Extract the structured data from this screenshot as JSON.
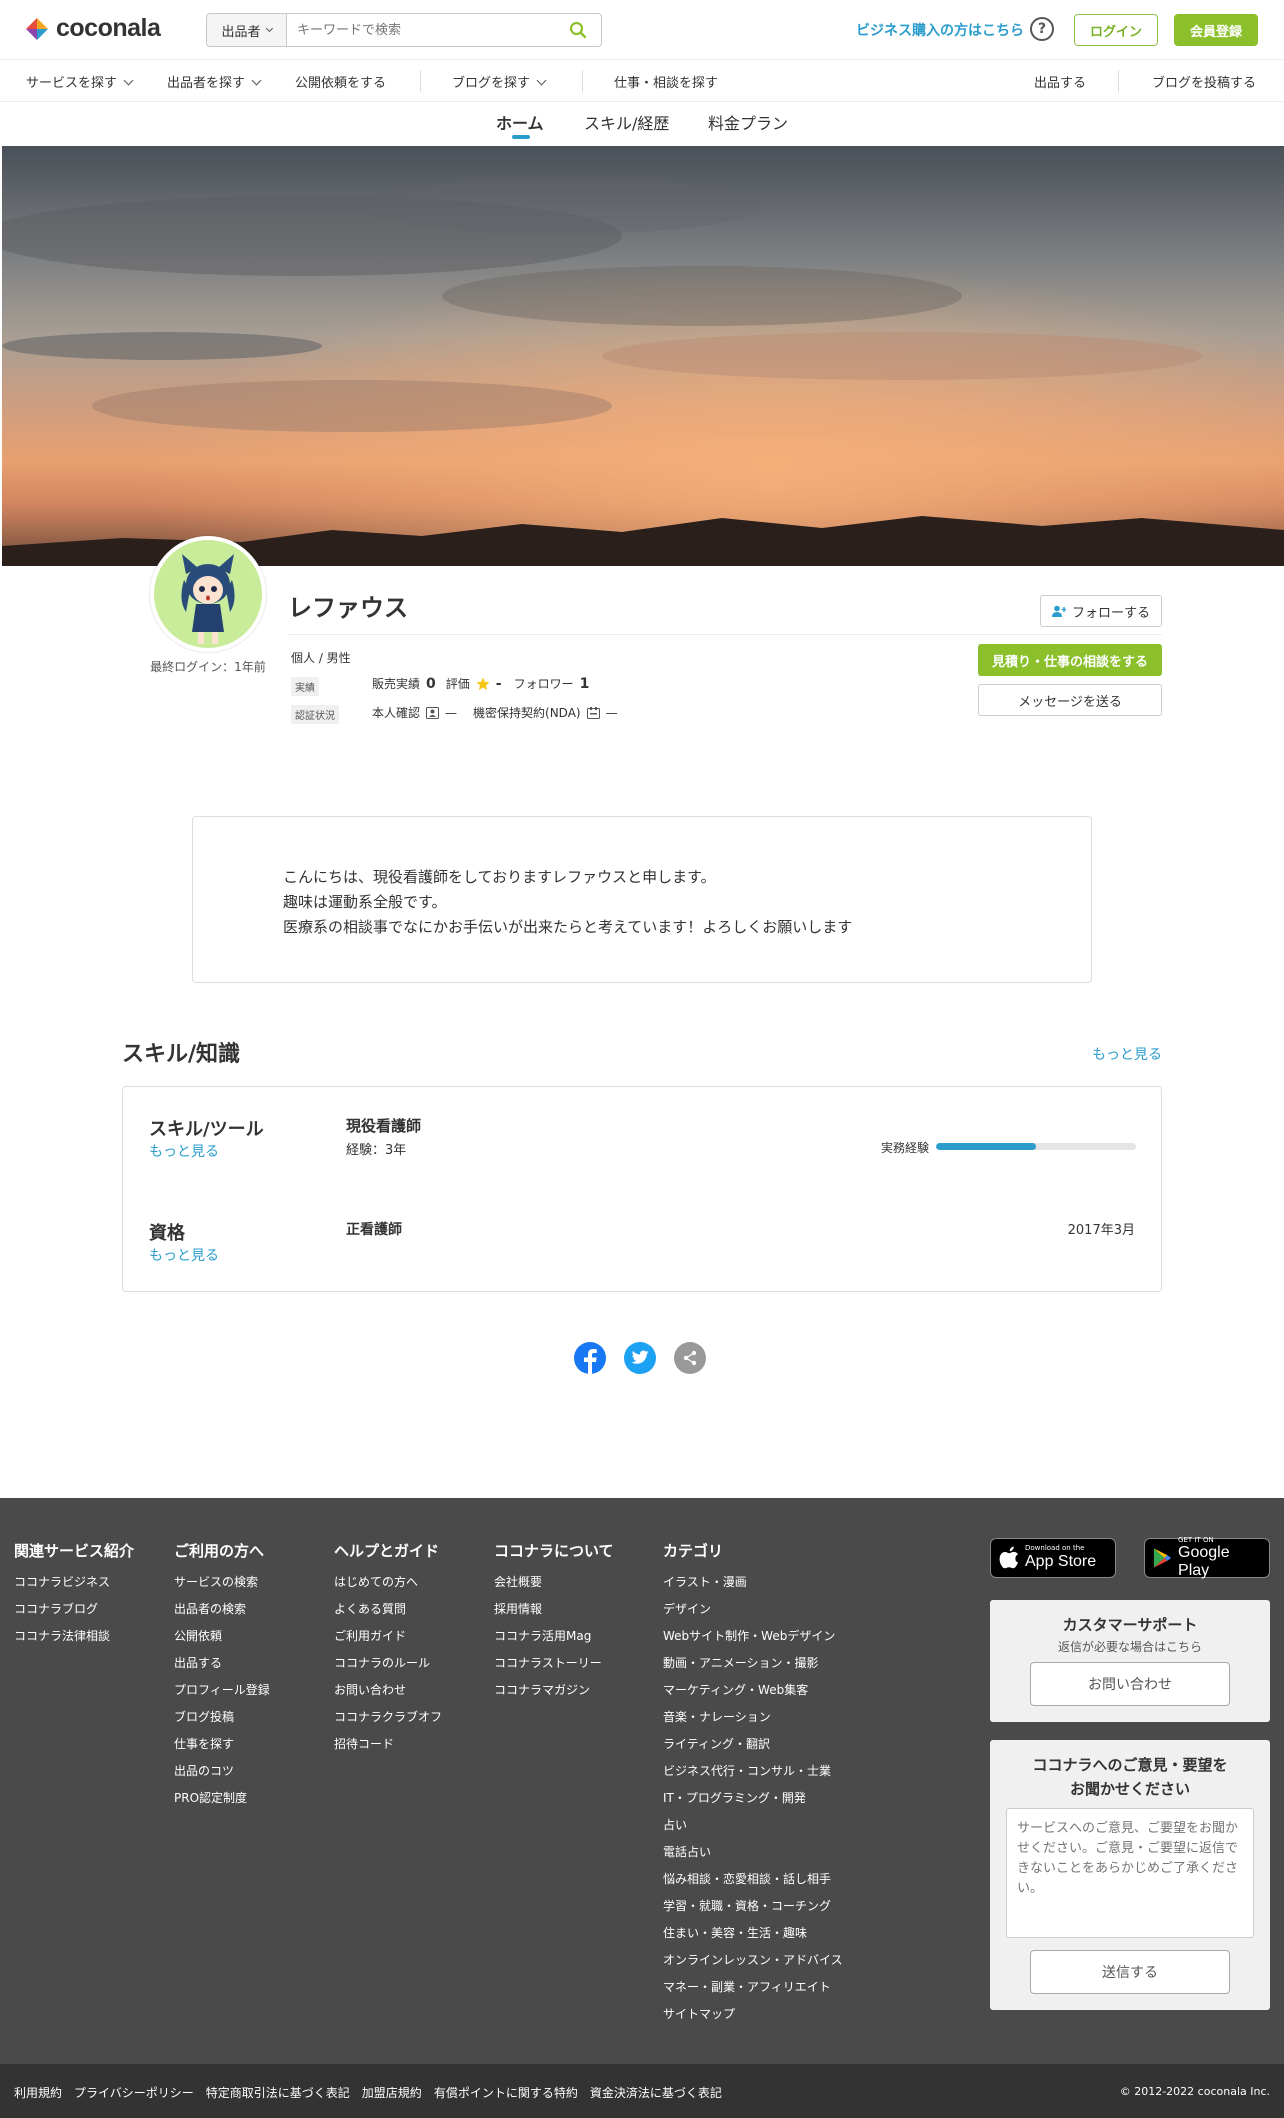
{
  "header": {
    "logo_text": "coconala",
    "search_select": "出品者",
    "search_placeholder": "キーワードで検索",
    "business_link": "ビジネス購入の方はこちら",
    "help": "?",
    "login": "ログイン",
    "signup": "会員登録"
  },
  "nav": {
    "items": [
      "サービスを探す",
      "出品者を探す",
      "公開依頼をする",
      "ブログを探す",
      "仕事・相談を探す",
      "出品する",
      "ブログを投稿する"
    ]
  },
  "tabs": [
    "ホーム",
    "スキル/経歴",
    "料金プラン"
  ],
  "profile": {
    "last_login": "最終ログイン：1年前",
    "name": "レファウス",
    "follow": "フォローする",
    "gender": "個人 / 男性",
    "stats_label": "実績",
    "sales_label": "販売実績",
    "sales_value": "0",
    "rating_label": "評価",
    "rating_value": "-",
    "follower_label": "フォロワー",
    "follower_value": "1",
    "verify_label": "認証状況",
    "identity_label": "本人確認",
    "identity_value": "—",
    "nda_label": "機密保持契約(NDA)",
    "nda_value": "—",
    "consult_button": "見積り・仕事の相談をする",
    "message_button": "メッセージを送る"
  },
  "intro": {
    "lines": [
      "こんにちは、現役看護師をしておりますレファウスと申します。",
      "趣味は運動系全般です。",
      "医療系の相談事でなにかお手伝いが出来たらと考えています！よろしくお願いします"
    ]
  },
  "skills": {
    "title": "スキル/知識",
    "more": "もっと見る",
    "tools_head": "スキル/ツール",
    "tools_more": "もっと見る",
    "tool_name": "現役看護師",
    "tool_exp": "経験：3年",
    "exp_label": "実務経験",
    "exp_level": 0.5,
    "qual_head": "資格",
    "qual_more": "もっと見る",
    "qual_name": "正看護師",
    "qual_date": "2017年3月"
  },
  "footer": {
    "col1": {
      "head": "関連サービス紹介",
      "links": [
        "ココナラビジネス",
        "ココナラブログ",
        "ココナラ法律相談"
      ]
    },
    "col2": {
      "head": "ご利用の方へ",
      "links": [
        "サービスの検索",
        "出品者の検索",
        "公開依頼",
        "出品する",
        "プロフィール登録",
        "ブログ投稿",
        "仕事を探す",
        "出品のコツ",
        "PRO認定制度"
      ]
    },
    "col3": {
      "head": "ヘルプとガイド",
      "links": [
        "はじめての方へ",
        "よくある質問",
        "ご利用ガイド",
        "ココナラのルール",
        "お問い合わせ",
        "ココナラクラブオフ",
        "招待コード"
      ]
    },
    "col4": {
      "head": "ココナラについて",
      "links": [
        "会社概要",
        "採用情報",
        "ココナラ活用Mag",
        "ココナラストーリー",
        "ココナラマガジン"
      ]
    },
    "col5": {
      "head": "カテゴリ",
      "links": [
        "イラスト・漫画",
        "デザイン",
        "Webサイト制作・Webデザイン",
        "動画・アニメーション・撮影",
        "マーケティング・Web集客",
        "音楽・ナレーション",
        "ライティング・翻訳",
        "ビジネス代行・コンサル・士業",
        "IT・プログラミング・開発",
        "占い",
        "電話占い",
        "悩み相談・恋愛相談・話し相手",
        "学習・就職・資格・コーチング",
        "住まい・美容・生活・趣味",
        "オンラインレッスン・アドバイス",
        "マネー・副業・アフィリエイト",
        "サイトマップ"
      ]
    },
    "appstore_small": "Download on the",
    "appstore_big": "App Store",
    "googleplay_small": "GET IT ON",
    "googleplay_big": "Google Play",
    "support_title": "カスタマーサポート",
    "support_sub": "返信が必要な場合はこちら",
    "support_button": "お問い合わせ",
    "feedback_title_1": "ココナラへのご意見・要望を",
    "feedback_title_2": "お聞かせください",
    "feedback_placeholder": "サービスへのご意見、ご要望をお聞かせください。ご意見・ご要望に返信できないことをあらかじめご了承ください。",
    "feedback_button": "送信する"
  },
  "bottom": {
    "links": [
      "利用規約",
      "プライバシーポリシー",
      "特定商取引法に基づく表記",
      "加盟店規約",
      "有償ポイントに関する特約",
      "資金決済法に基づく表記"
    ],
    "copyright": "© 2012-2022 coconala Inc."
  },
  "colors": {
    "accent_green": "#8bc02b",
    "link_blue": "#2b9dcc",
    "footer_bg": "#4a4a4a"
  }
}
